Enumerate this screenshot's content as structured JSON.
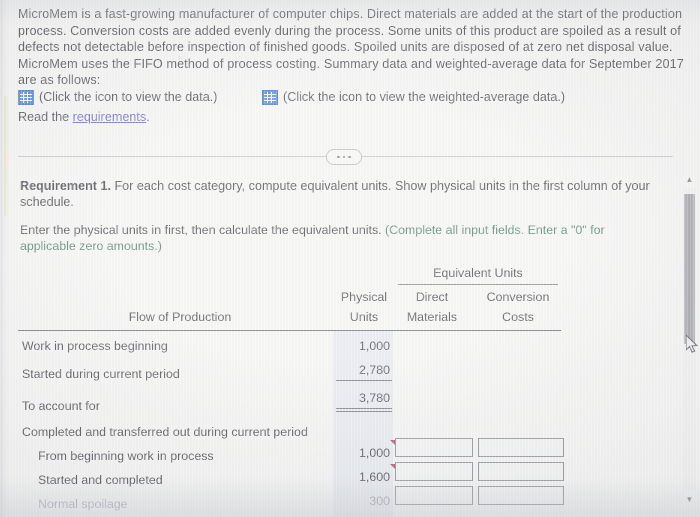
{
  "intro": {
    "paragraph": "MicroMem is a fast-growing manufacturer of computer chips. Direct materials are added at the start of the production process. Conversion costs are added evenly during the process. Some units of this product are spoiled as a result of defects not detectable before inspection of finished goods. Spoiled units are disposed of at zero net disposal value. MicroMem uses the FIFO method of process costing. Summary data and weighted-average data for September 2017 are as follows:"
  },
  "links": {
    "data_icon_text": "(Click the icon to view the data.)",
    "wavg_icon_text": "(Click the icon to view the weighted-average data.)",
    "data_icon_name": "table-grid-icon",
    "wavg_icon_name": "table-grid-icon",
    "read_prefix": "Read the ",
    "requirements_link": "requirements",
    "read_suffix": "."
  },
  "divider": {
    "dots_label": "..."
  },
  "requirement": {
    "label": "Requirement 1.",
    "body": " For each cost category, compute equivalent units. Show physical units in the first column of your schedule.",
    "instruction_plain": "Enter the physical units in first, then calculate the equivalent units. ",
    "instruction_green": "(Complete all input fields. Enter a \"0\" for applicable zero amounts.)"
  },
  "table": {
    "group_header": "Equivalent Units",
    "col_flow": "Flow of Production",
    "col_physical_l1": "Physical",
    "col_physical_l2": "Units",
    "col_dm_l1": "Direct",
    "col_dm_l2": "Materials",
    "col_cc_l1": "Conversion",
    "col_cc_l2": "Costs",
    "rows": [
      {
        "label": "Work in process beginning",
        "physical": "1,000"
      },
      {
        "label": "Started during current period",
        "physical": "2,780"
      },
      {
        "label": "To account for",
        "physical": "3,780"
      },
      {
        "label": "Completed and transferred out during current period",
        "physical": ""
      },
      {
        "label": "From beginning work in process",
        "physical": "1,000"
      },
      {
        "label": "Started and completed",
        "physical": "1,600"
      },
      {
        "label": "Normal spoilage",
        "physical": "300"
      }
    ],
    "input_value": ""
  },
  "scrollbar": {
    "up_arrow": "▲",
    "down_arrow": "▼"
  },
  "colors": {
    "accent_blue": "#2f6fd0",
    "link_purple": "#4a4ab0",
    "green_note": "#2f6b4f",
    "flag_red": "#9d2f3f",
    "shade_column": "#dfe3ea"
  }
}
